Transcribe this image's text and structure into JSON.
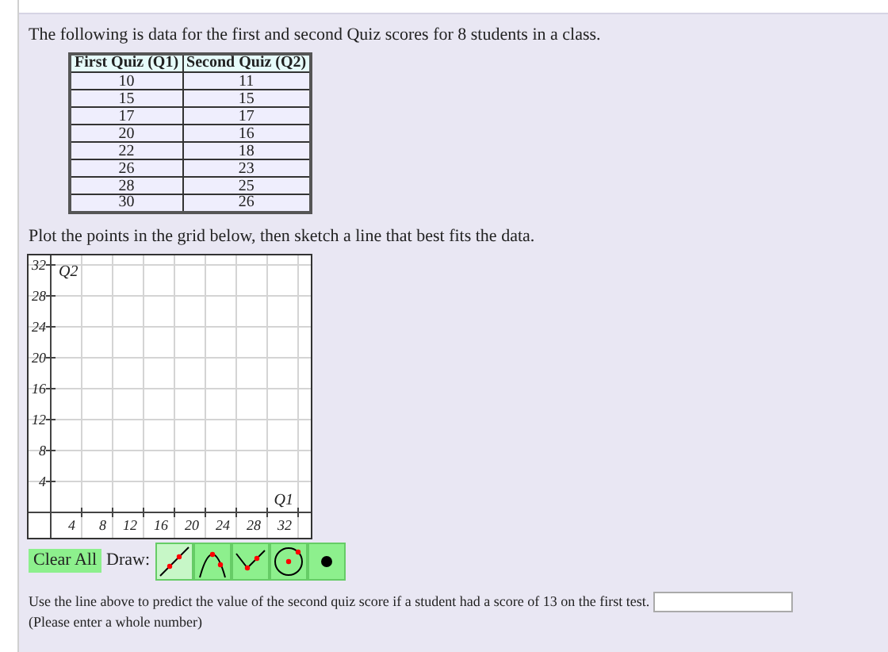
{
  "intro": "The following is data for the first and second Quiz scores for 8 students in a class.",
  "table": {
    "columns": [
      "First Quiz (Q1)",
      "Second Quiz (Q2)"
    ],
    "rows": [
      [
        "10",
        "11"
      ],
      [
        "15",
        "15"
      ],
      [
        "17",
        "17"
      ],
      [
        "20",
        "16"
      ],
      [
        "22",
        "18"
      ],
      [
        "26",
        "23"
      ],
      [
        "28",
        "25"
      ],
      [
        "30",
        "26"
      ]
    ]
  },
  "plot_instruction": "Plot the points in the grid below, then sketch a line that best fits the data.",
  "graph": {
    "x_label": "Q1",
    "y_label": "Q2",
    "x_ticks": [
      "4",
      "8",
      "12",
      "16",
      "20",
      "24",
      "28",
      "32"
    ],
    "y_ticks": [
      "32",
      "28",
      "24",
      "20",
      "16",
      "12",
      "8",
      "4"
    ]
  },
  "clear_button": "Clear All",
  "draw_label": "Draw:",
  "draw_tools": [
    {
      "kind": "line",
      "selected": true
    },
    {
      "kind": "parabola",
      "selected": false
    },
    {
      "kind": "absolute",
      "selected": false
    },
    {
      "kind": "circle",
      "selected": false
    },
    {
      "kind": "point",
      "selected": false
    }
  ],
  "question": "Use the line above to predict the value of the second quiz score if a student had a score of 13 on the first test.",
  "answer_note": "(Please enter a whole number)"
}
